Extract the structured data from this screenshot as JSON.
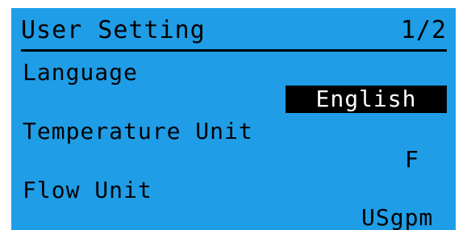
{
  "screen": {
    "title": "User Setting",
    "page_indicator": "1/2",
    "background_color": "#1f9de6",
    "text_color": "#000000",
    "highlight_color": "#000000"
  },
  "settings": [
    {
      "label": "Language",
      "value": "English",
      "selected": true
    },
    {
      "label": "Temperature Unit",
      "value": "F",
      "selected": false
    },
    {
      "label": "Flow Unit",
      "value": "USgpm",
      "selected": false
    }
  ]
}
